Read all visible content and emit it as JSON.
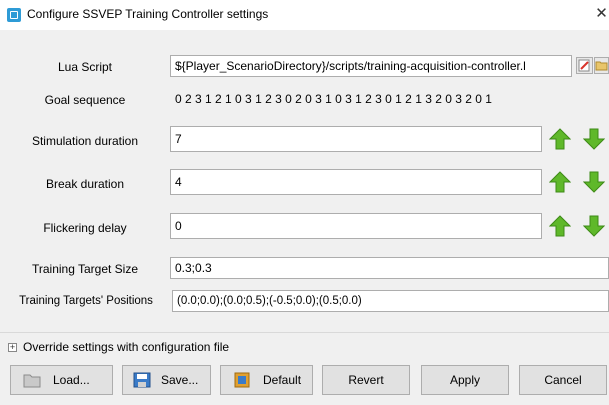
{
  "window": {
    "title": "Configure SSVEP Training Controller settings",
    "close_glyph": "✕"
  },
  "settings": {
    "lua_script": {
      "label": "Lua Script",
      "value": "${Player_ScenarioDirectory}/scripts/training-acquisition-controller.l"
    },
    "goal_sequence": {
      "label": "Goal sequence",
      "value": "0 2 3 1 2 1 0 3 1 2 3 0 2 0 3 1 0 3 1 2 3 0 1 2 1 3 2 0 3 2 0 1"
    },
    "stimulation_duration": {
      "label": "Stimulation duration",
      "value": "7"
    },
    "break_duration": {
      "label": "Break duration",
      "value": "4"
    },
    "flickering_delay": {
      "label": "Flickering delay",
      "value": "0"
    },
    "training_target_size": {
      "label": "Training Target Size",
      "value": "0.3;0.3"
    },
    "training_targets_positions": {
      "label": "Training Targets' Positions",
      "value": "(0.0;0.0);(0.0;0.5);(-0.5;0.0);(0.5;0.0)"
    }
  },
  "override": {
    "expander_glyph": "+",
    "label": "Override settings with configuration file"
  },
  "buttons": {
    "load": "Load...",
    "save": "Save...",
    "default": "Default",
    "revert": "Revert",
    "apply": "Apply",
    "cancel": "Cancel"
  },
  "colors": {
    "arrow_green": "#5fb82a",
    "accent_blue": "#2e9bd6"
  },
  "icons": {
    "edit": "edit-icon",
    "browse": "folder-browse-icon",
    "increase": "arrow-up-icon",
    "decrease": "arrow-down-icon",
    "load": "folder-open-icon",
    "save": "floppy-disk-icon",
    "default": "default-settings-icon"
  }
}
